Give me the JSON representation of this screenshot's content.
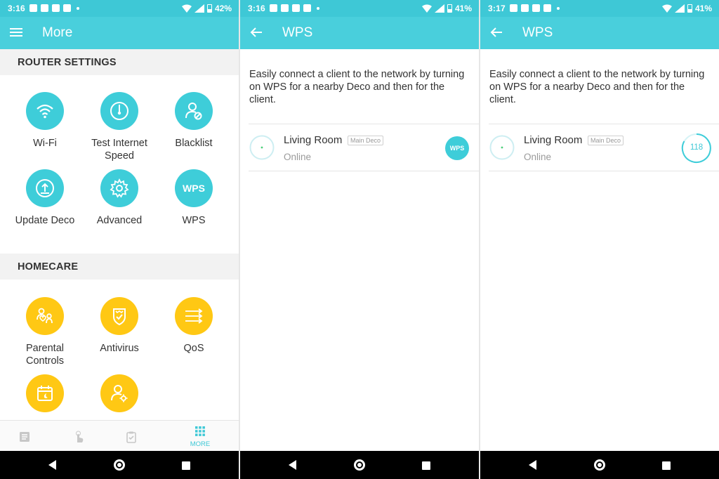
{
  "screens": [
    {
      "status": {
        "time": "3:16",
        "battery": "42%"
      },
      "title": "More",
      "router_settings": {
        "heading": "ROUTER SETTINGS",
        "items": [
          {
            "label": "Wi-Fi",
            "icon": "wifi-icon"
          },
          {
            "label": "Test Internet Speed",
            "icon": "speedometer-icon"
          },
          {
            "label": "Blacklist",
            "icon": "user-blocked-icon"
          },
          {
            "label": "Update Deco",
            "icon": "upload-icon"
          },
          {
            "label": "Advanced",
            "icon": "gear-icon"
          },
          {
            "label": "WPS",
            "icon_text": "WPS"
          }
        ]
      },
      "homecare": {
        "heading": "HOMECARE",
        "items": [
          {
            "label": "Parental Controls",
            "icon": "family-icon"
          },
          {
            "label": "Antivirus",
            "icon": "shield-icon"
          },
          {
            "label": "QoS",
            "icon": "arrows-icon"
          },
          {
            "label": "",
            "icon": "calendar-moon-icon"
          },
          {
            "label": "",
            "icon": "user-gear-icon"
          }
        ]
      },
      "bottom_nav": [
        {
          "icon": "list-icon",
          "label": ""
        },
        {
          "icon": "hand-tap-icon",
          "label": ""
        },
        {
          "icon": "clipboard-check-icon",
          "label": ""
        },
        {
          "icon": "grid-icon",
          "label": "MORE"
        }
      ]
    },
    {
      "status": {
        "time": "3:16",
        "battery": "41%"
      },
      "title": "WPS",
      "description": "Easily connect a client to the network by turning on WPS for a nearby Deco and then for the client.",
      "device": {
        "name": "Living Room",
        "badge": "Main Deco",
        "status": "Online",
        "action": "WPS"
      }
    },
    {
      "status": {
        "time": "3:17",
        "battery": "41%"
      },
      "title": "WPS",
      "description": "Easily connect a client to the network by turning on WPS for a nearby Deco and then for the client.",
      "device": {
        "name": "Living Room",
        "badge": "Main Deco",
        "status": "Online",
        "countdown": "118"
      }
    }
  ],
  "colors": {
    "header": "#49cfdc",
    "accent": "#3ecdd9",
    "homecare": "#ffc814"
  }
}
